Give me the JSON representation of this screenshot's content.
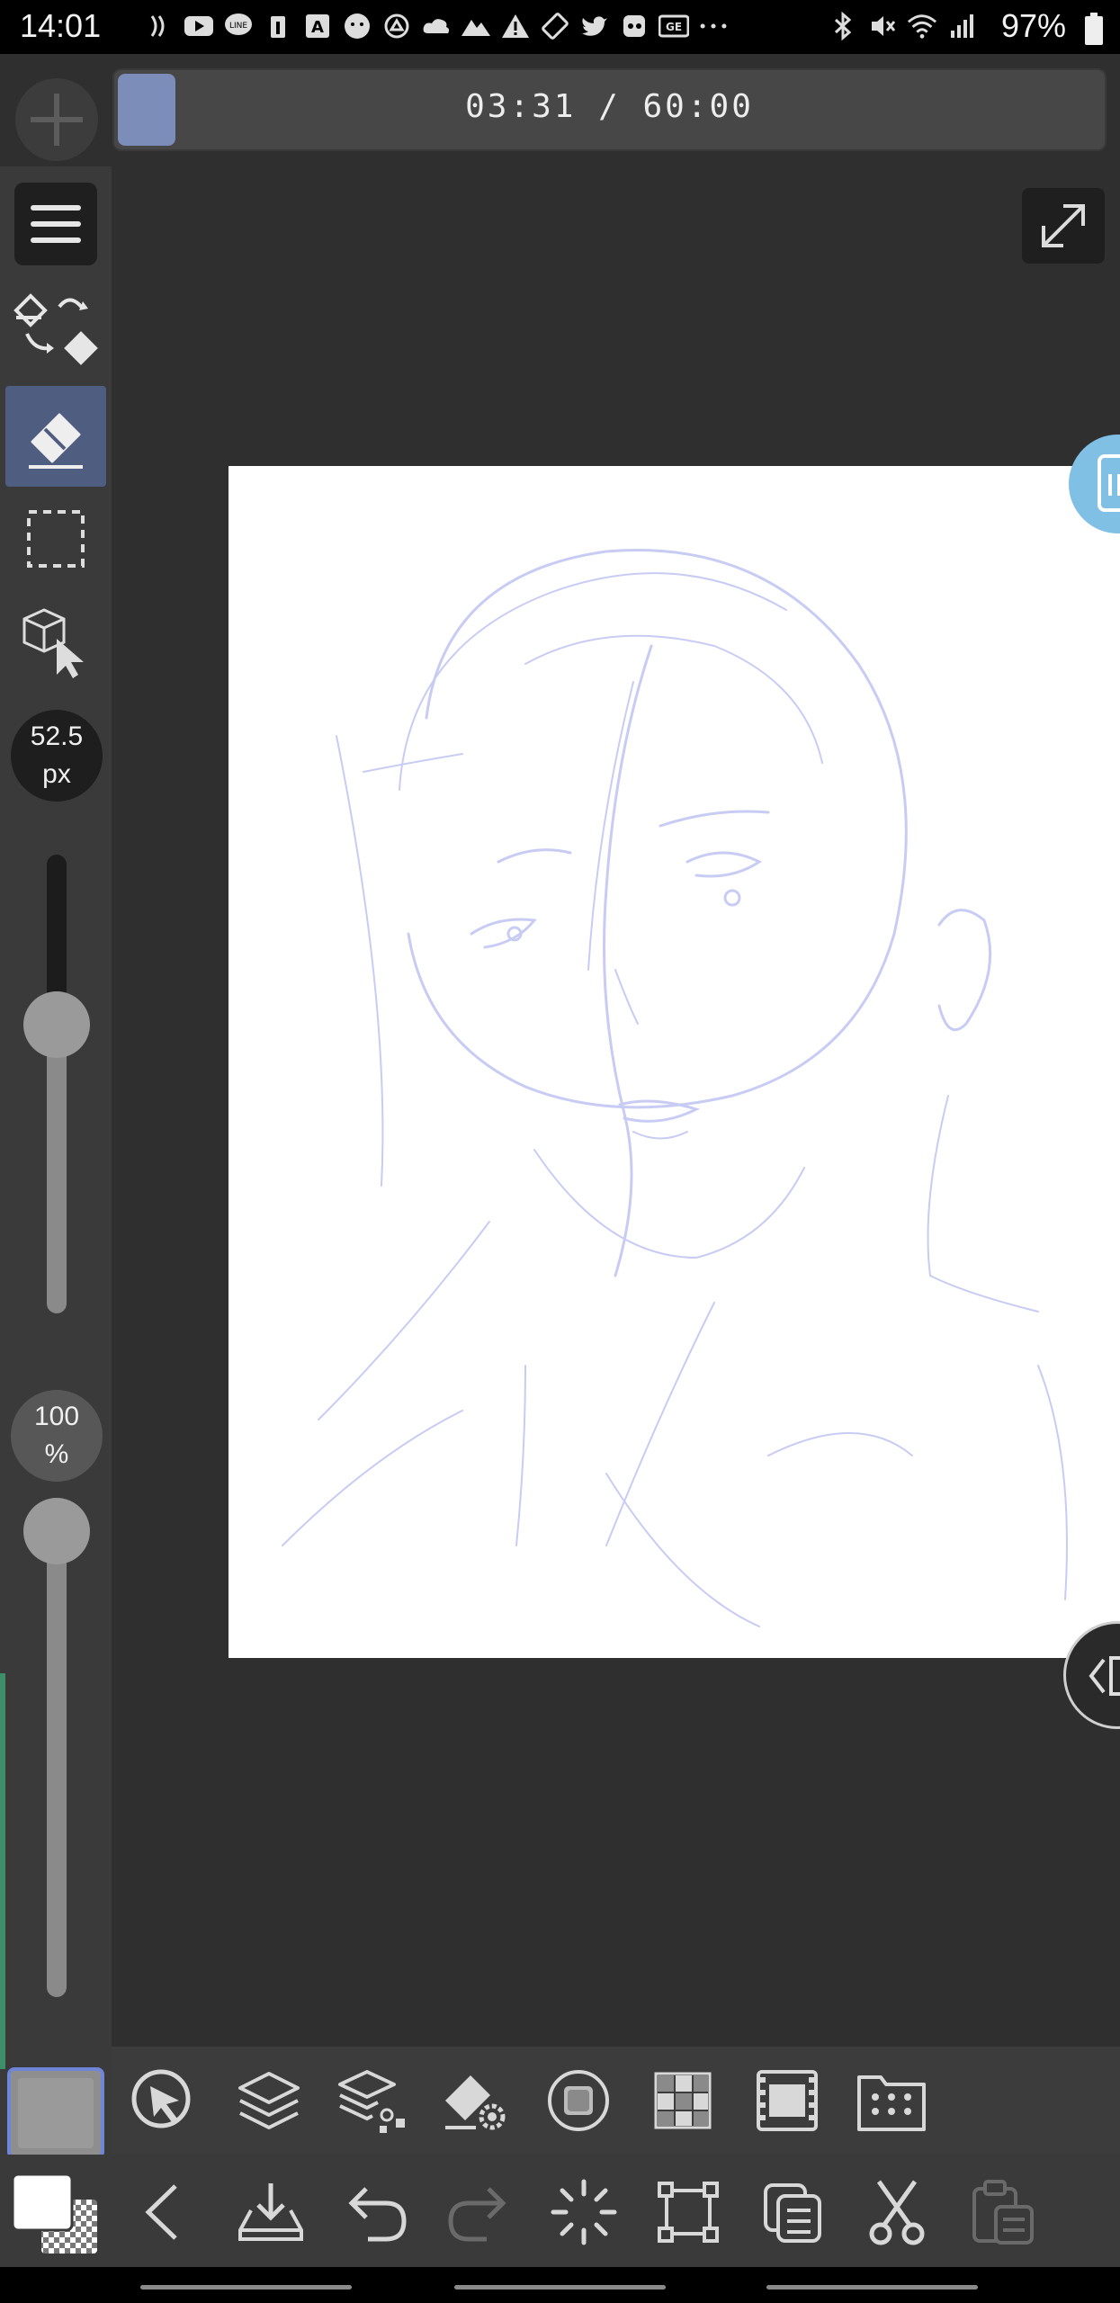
{
  "status_bar": {
    "time": "14:01",
    "battery": "97%"
  },
  "timer": {
    "text": "03:31 / 60:00",
    "progress": 0.0586
  },
  "toolbar": {
    "brush_size": {
      "value": "52.5",
      "unit": "px",
      "level": 0.7
    },
    "opacity": {
      "value": "100",
      "unit": "%",
      "level": 1.0
    }
  },
  "colors": {
    "accent": "#7b8db8",
    "active_tool_bg": "#4e5d80",
    "main_color_border": "#6f86d8",
    "main_color": "#9a9a9a",
    "sketch_stroke": "#c8ccf4"
  },
  "icons": {
    "status": [
      "wifi-calling-icon",
      "youtube-icon",
      "line-icon",
      "news-icon",
      "translate-icon",
      "avatar-icon",
      "app-icon",
      "cloud-icon",
      "mountain-icon",
      "warning-icon",
      "rotate-icon",
      "twitter-icon",
      "game-icon",
      "gs-icon",
      "more-icon",
      "bluetooth-icon",
      "mute-icon",
      "wifi-icon",
      "signal-icon"
    ],
    "panel_bar": [
      "navigator-icon",
      "layers-icon",
      "layer-property-icon",
      "tool-property-icon",
      "brush-icon",
      "color-set-icon",
      "timeline-icon",
      "materials-icon"
    ],
    "command_bar": [
      "back-icon",
      "save-icon",
      "undo-icon",
      "redo-icon",
      "loading-icon",
      "transform-icon",
      "copy-icon",
      "cut-icon",
      "paste-icon"
    ]
  }
}
